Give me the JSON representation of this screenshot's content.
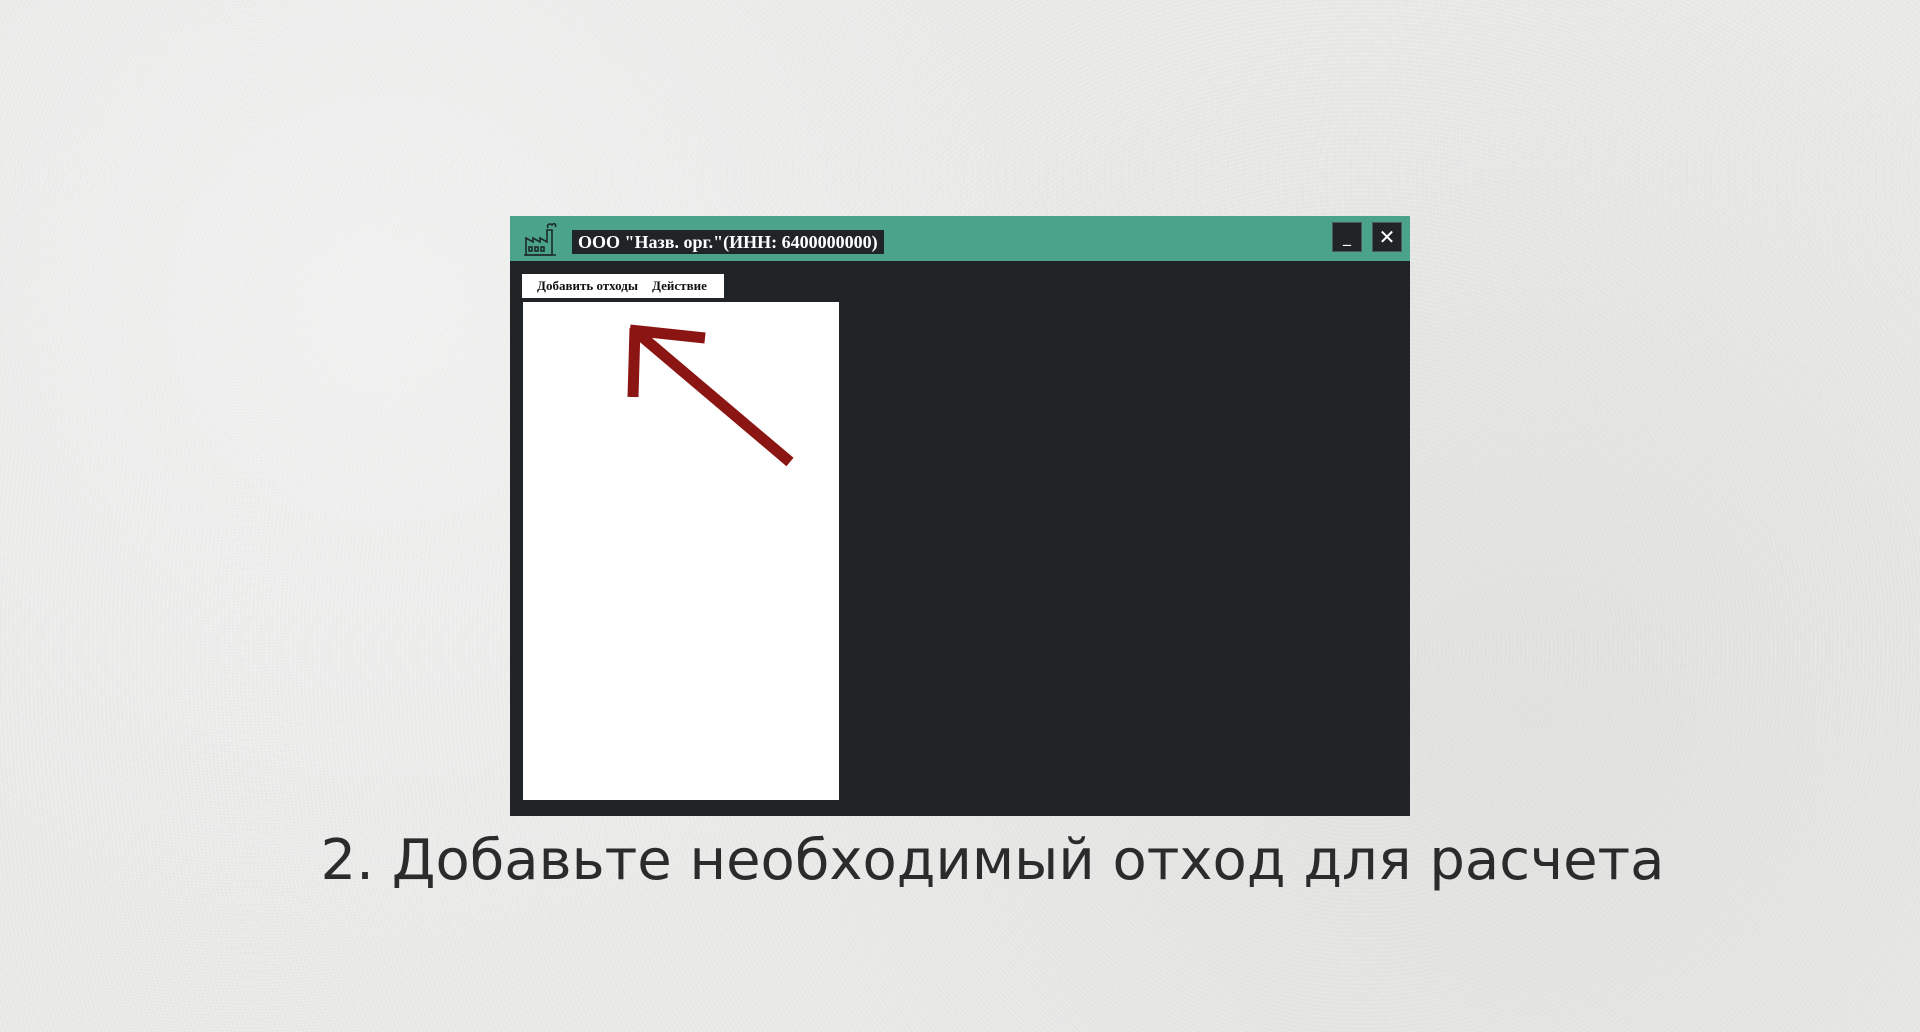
{
  "window": {
    "title": "ООО \"Назв. орг.\"(ИНН: 6400000000)",
    "icon": "factory-icon",
    "minimize_label": "_",
    "close_label": "✕"
  },
  "menu": {
    "items": [
      {
        "label": "Добавить отходы"
      },
      {
        "label": "Действие"
      }
    ]
  },
  "annotation": {
    "icon": "arrow-up-left-icon",
    "color": "#8b1513"
  },
  "caption": "2. Добавьте необходимый отход для расчета",
  "colors": {
    "title_bar": "#4aa38a",
    "window_body": "#212427",
    "background": "#e9eae8"
  }
}
